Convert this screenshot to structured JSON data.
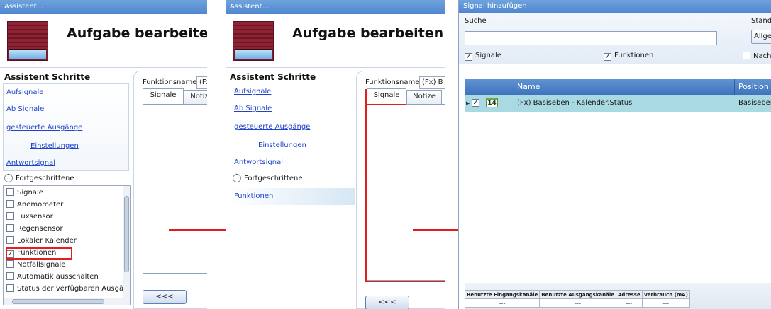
{
  "panel1": {
    "title": "Assistent...",
    "heading": "Aufgabe bearbeiten",
    "steps_title": "Assistent Schritte",
    "steps": [
      "Aufsignale",
      "Ab Signale",
      "gesteuerte Ausgänge",
      "Einstellungen",
      "Antwortsignal"
    ],
    "advanced_label": "Fortgeschrittene",
    "advanced_icon": "chevron-up-icon",
    "checklist": [
      {
        "label": "Signale",
        "checked": false
      },
      {
        "label": "Anemometer",
        "checked": false
      },
      {
        "label": "Luxsensor",
        "checked": false
      },
      {
        "label": "Regensensor",
        "checked": false
      },
      {
        "label": "Lokaler Kalender",
        "checked": false
      },
      {
        "label": "Funktionen",
        "checked": true
      },
      {
        "label": "Notfallsignale",
        "checked": false
      },
      {
        "label": "Automatik ausschalten",
        "checked": false
      },
      {
        "label": "Status der verfügbaren Ausgä",
        "checked": false
      }
    ],
    "fname_label": "Funktionsname",
    "fname_value": "(Fx)",
    "tabs": [
      "Signale",
      "Notiz"
    ],
    "back_button": "<<<"
  },
  "panel2": {
    "title": "Assistent...",
    "heading": "Aufgabe bearbeiten",
    "steps_title": "Assistent Schritte",
    "steps": [
      "Aufsignale",
      "Ab Signale",
      "gesteuerte Ausgänge",
      "Einstellungen",
      "Antwortsignal"
    ],
    "advanced_label": "Fortgeschrittene",
    "advanced_icon": "chevron-down-icon",
    "functions_link": "Funktionen",
    "fname_label": "Funktionsname",
    "fname_value": "(Fx) B",
    "tabs": [
      "Signale",
      "Notize"
    ],
    "back_button": "<<<"
  },
  "dialog": {
    "title": "Signal hinzufügen",
    "search_label": "Suche",
    "search_value": "",
    "standard_label": "Stand",
    "standard_value": "Allge",
    "filter_signals": {
      "label": "Signale",
      "checked": true
    },
    "filter_functions": {
      "label": "Funktionen",
      "checked": true
    },
    "filter_nach": {
      "label": "Nach",
      "checked": false
    },
    "columns": [
      "Name",
      "Position N"
    ],
    "row": {
      "icon_label": "14",
      "name": "(Fx) Basiseben - Kalender.Status",
      "position": "Basiseber",
      "checked": true
    },
    "stats_headers": [
      "Benutzte Eingangskanäle",
      "Benutzte Ausgangskanäle",
      "Adresse",
      "Verbrauch (mA)"
    ],
    "stats_values": [
      "---",
      "---",
      "---",
      "---"
    ]
  },
  "colors": {
    "titlebar": "#4f87cf",
    "link": "#1f44c8",
    "highlight": "#e02020",
    "selected_row": "#a9d9e2",
    "grid_header": "#3f74bd"
  }
}
